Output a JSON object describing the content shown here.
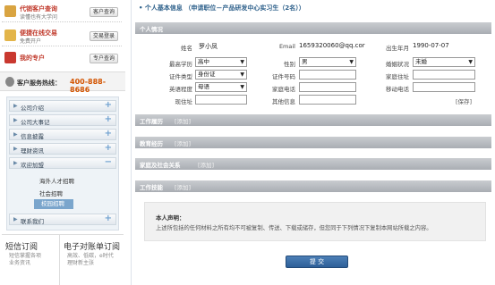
{
  "sidebar": {
    "quick": [
      {
        "title": "代销客户查询",
        "desc": "读懂也有大学问",
        "button": "客户查询",
        "icon": "user-search-icon",
        "color": "#d9a441"
      },
      {
        "title": "便捷在线交易",
        "desc": "免费开户",
        "button": "交易登录",
        "icon": "trade-icon",
        "color": "#e3b54a"
      },
      {
        "title": "我的专户",
        "desc": "",
        "button": "专户查询",
        "icon": "account-icon",
        "color": "#c9382f"
      }
    ],
    "hotline": {
      "label": "客户服务热线：",
      "number": "400-888-8686"
    },
    "nav": [
      {
        "label": "公司介绍",
        "sign": "+"
      },
      {
        "label": "公司大事记",
        "sign": "+"
      },
      {
        "label": "信息披露",
        "sign": "+"
      },
      {
        "label": "理财资讯",
        "sign": "+"
      },
      {
        "label": "欢迎加盟",
        "sign": "−"
      }
    ],
    "sub": [
      "海外人才招聘",
      "社会招聘",
      "校园招聘"
    ],
    "nav_last": {
      "label": "联系我们",
      "sign": "+"
    },
    "promo": [
      {
        "title": "短信订阅",
        "desc1": "短信掌握各项",
        "desc2": "业务资讯"
      },
      {
        "title": "电子对账单订阅",
        "desc1": "高效、低碳，e时代",
        "desc2": "理财新主张"
      }
    ]
  },
  "main": {
    "header": "个人基本信息",
    "header_sub": "（申请职位－产品研发中心实习生（2名））",
    "sections": {
      "personal": "个人情况",
      "work": "工作履历",
      "edu": "教育经历",
      "family": "家庭及社会关系",
      "skills": "工作技能",
      "add": "[添加]"
    },
    "form": {
      "name_label": "姓名",
      "name_value": "罗小凤",
      "email_label": "Email",
      "email_value": "1659320060@qq.cor",
      "birth_label": "出生年月",
      "birth_value": "1990-07-07",
      "edu_label": "最高学历",
      "edu_value": "高中",
      "gender_label": "性别",
      "gender_value": "男",
      "marital_label": "婚姻状况",
      "marital_value": "未婚",
      "idtype_label": "证件类型",
      "idtype_value": "身份证",
      "idno_label": "证件号码",
      "idno_value": "",
      "homeaddr_label": "家庭住址",
      "homeaddr_value": "",
      "eng_label": "英语程度",
      "eng_value": "母语",
      "homephone_label": "家庭电话",
      "homephone_value": "",
      "mobile_label": "移动电话",
      "mobile_value": "",
      "addr_label": "现住址",
      "addr_value": "",
      "other_label": "其他信息",
      "other_value": "",
      "save": "[保存]"
    },
    "declaration": {
      "title": "本人声明：",
      "text": "上述所包括的任何材料之所有均不可被复制、传送、下载或储存，但您同于下列情况下复制本网站所载之内容。"
    },
    "submit": "提 交"
  }
}
